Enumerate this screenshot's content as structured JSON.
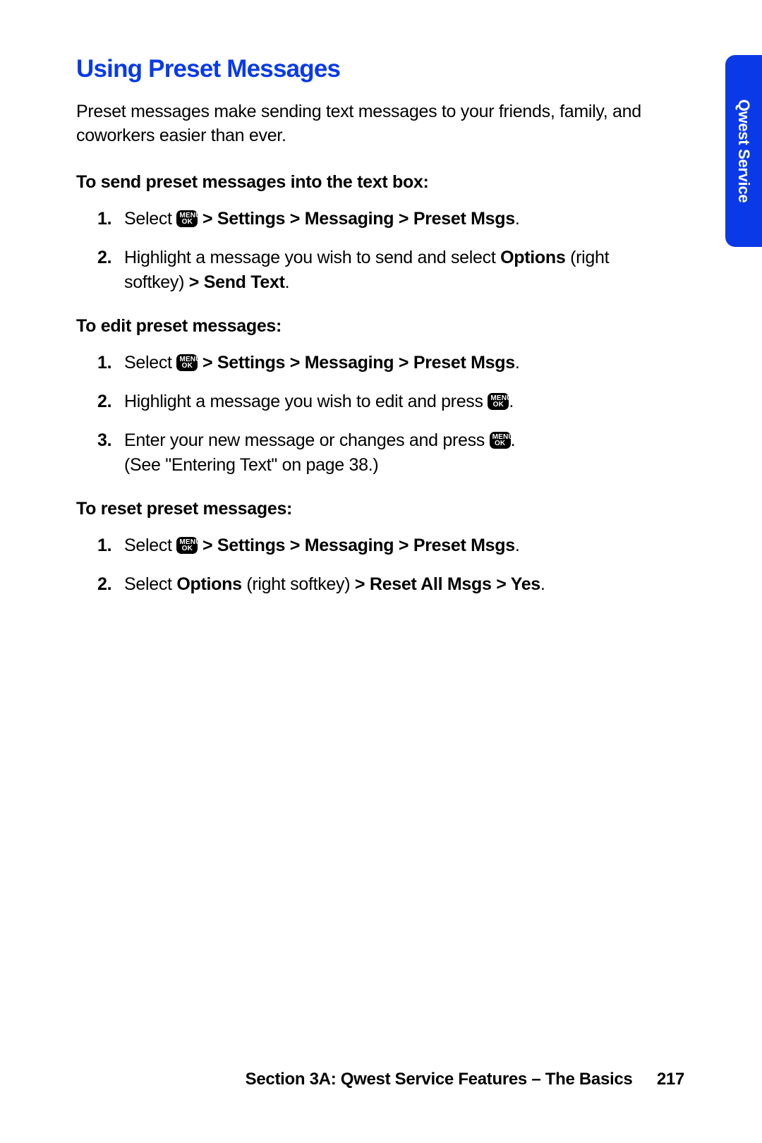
{
  "sideTab": "Qwest Service",
  "heading": "Using Preset Messages",
  "intro": "Preset messages make sending text messages to your friends, family, and coworkers easier than ever.",
  "menuKey": {
    "line1": "MENU",
    "line2": "OK"
  },
  "sections": [
    {
      "title": "To send preset messages into the text box:",
      "steps": [
        {
          "pre": "Select ",
          "hasKey": true,
          "postBold": " > Settings > Messaging > Preset Msgs",
          "tail": "."
        },
        {
          "pre": "Highlight a message you wish to send and select ",
          "bold1": "Options",
          "mid": " (right softkey) ",
          "bold2": "> Send Text",
          "tail": "."
        }
      ]
    },
    {
      "title": "To edit preset messages:",
      "steps": [
        {
          "pre": "Select ",
          "hasKey": true,
          "postBold": " > Settings > Messaging > Preset Msgs",
          "tail": "."
        },
        {
          "pre": "Highlight a message you wish to edit and press ",
          "hasKeyEnd": true,
          "tail": "."
        },
        {
          "pre": "Enter your new message or changes and press ",
          "hasKeyEnd": true,
          "tail": ".",
          "note": "(See \"Entering Text\" on page 38.)"
        }
      ]
    },
    {
      "title": "To reset preset messages:",
      "steps": [
        {
          "pre": "Select ",
          "hasKey": true,
          "postBold": " > Settings > Messaging > Preset Msgs",
          "tail": "."
        },
        {
          "pre": "Select ",
          "bold1": "Options",
          "mid": " (right softkey) ",
          "bold2": "> Reset All Msgs > Yes",
          "tail": "."
        }
      ]
    }
  ],
  "footer": {
    "text": "Section 3A: Qwest Service Features – The Basics",
    "page": "217"
  }
}
